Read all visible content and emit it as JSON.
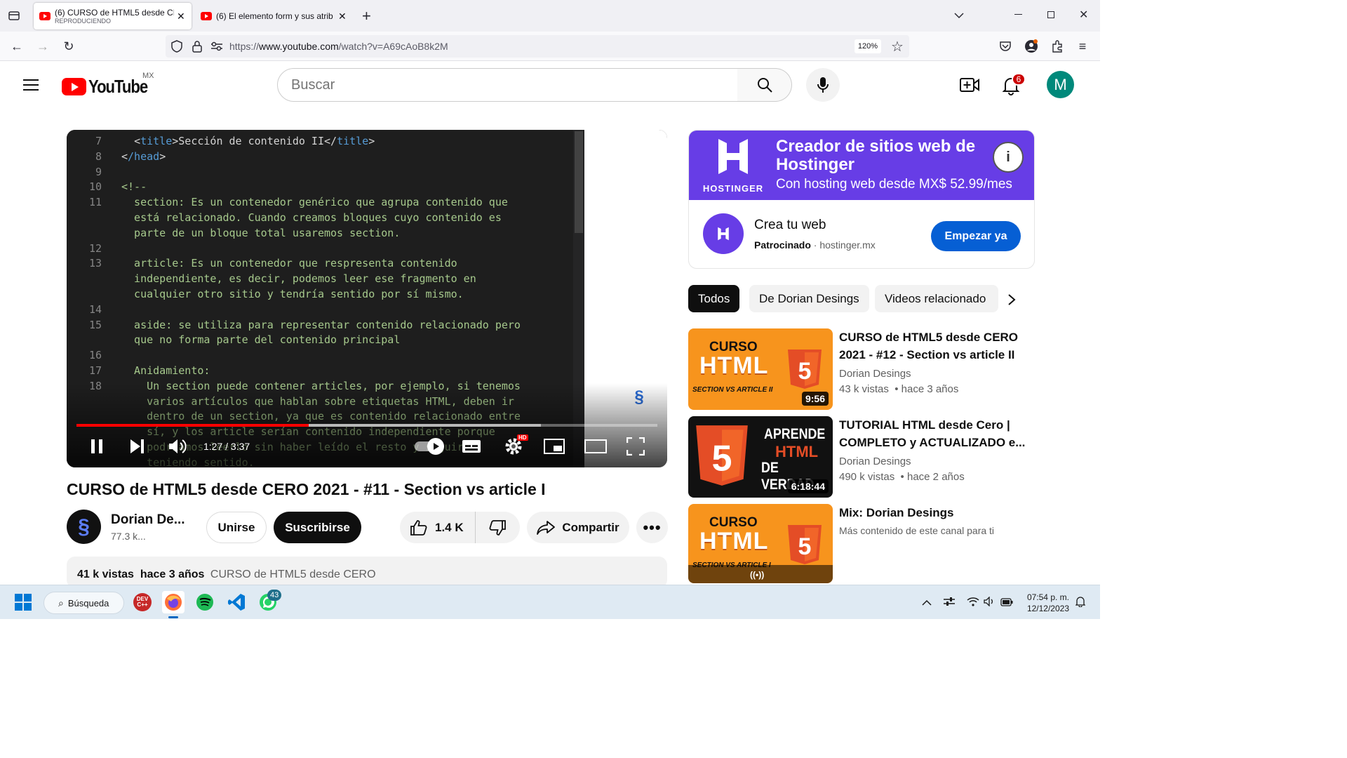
{
  "browser": {
    "tabs": [
      {
        "title": "(6) CURSO de HTML5 desde CE",
        "subtitle": "REPRODUCIENDO",
        "active": true
      },
      {
        "title": "(6) El elemento form y sus atrib",
        "active": false
      }
    ],
    "url_prefix": "https://",
    "url_host": "www.youtube.com",
    "url_path": "/watch?v=A69cAoB8k2M",
    "zoom": "120%"
  },
  "youtube": {
    "logo_text": "YouTube",
    "country": "MX",
    "search_placeholder": "Buscar",
    "notifications": "6",
    "avatar_letter": "M"
  },
  "video": {
    "code_lines": [
      {
        "n": "7",
        "text": "  <title>Sección de contenido II</title>"
      },
      {
        "n": "8",
        "text": "</head>"
      },
      {
        "n": "9",
        "text": ""
      },
      {
        "n": "10",
        "text": "<!--"
      },
      {
        "n": "11",
        "text": "  section: Es un contenedor genérico que agrupa contenido que"
      },
      {
        "n": "",
        "text": "  está relacionado. Cuando creamos bloques cuyo contenido es"
      },
      {
        "n": "",
        "text": "  parte de un bloque total usaremos section."
      },
      {
        "n": "12",
        "text": ""
      },
      {
        "n": "13",
        "text": "  article: Es un contenedor que respresenta contenido"
      },
      {
        "n": "",
        "text": "  independiente, es decir, podemos leer ese fragmento en"
      },
      {
        "n": "",
        "text": "  cualquier otro sitio y tendría sentido por sí mismo."
      },
      {
        "n": "14",
        "text": ""
      },
      {
        "n": "15",
        "text": "  aside: se utiliza para representar contenido relacionado pero"
      },
      {
        "n": "",
        "text": "  que no forma parte del contenido principal"
      },
      {
        "n": "16",
        "text": ""
      },
      {
        "n": "17",
        "text": "  Anidamiento:"
      },
      {
        "n": "18",
        "text": "    Un section puede contener articles, por ejemplo, si tenemos"
      },
      {
        "n": "",
        "text": "    varios artículos que hablan sobre etiquetas HTML, deben ir"
      },
      {
        "n": "",
        "text": "    dentro de un section, ya que es contenido relacionado entre"
      },
      {
        "n": "",
        "text": "    sí, y los article serían contenido independiente porque"
      },
      {
        "n": "",
        "text": "    podríamos leerlo sin haber leído el resto y seguiría"
      },
      {
        "n": "",
        "text": "    teniendo sentido."
      }
    ],
    "time_current": "1:27",
    "time_total": "3:37",
    "progress": 0.4,
    "buffered": 0.8,
    "title": "CURSO de HTML5 desde CERO 2021 - #11 - Section vs article I",
    "channel_name": "Dorian De...",
    "subscribers": "77.3 k...",
    "join_label": "Unirse",
    "subscribe_label": "Suscribirse",
    "likes": "1.4 K",
    "share_label": "Compartir",
    "views": "41 k vistas",
    "age": "hace 3 años",
    "playlist_tag": "CURSO de HTML5 desde CERO"
  },
  "ad": {
    "banner_title": "Creador de sitios web de Hostinger",
    "banner_sub": "Con hosting web desde MX$ 52.99/mes",
    "brand": "HOSTINGER",
    "name": "Crea tu web",
    "sponsored": "Patrocinado",
    "domain": "hostinger.mx",
    "cta": "Empezar ya"
  },
  "chips": [
    "Todos",
    "De Dorian Desings",
    "Videos relacionado"
  ],
  "recommendations": [
    {
      "title": "CURSO de HTML5 desde CERO 2021 - #12 - Section vs article II",
      "channel": "Dorian Desings",
      "views": "43 k vistas",
      "age": "hace 3 años",
      "duration": "9:56",
      "thumb_top": "CURSO",
      "thumb_main": "HTML",
      "thumb_bottom": "SECTION VS ARTICLE II",
      "thumb_color": "#f7941d"
    },
    {
      "title": "TUTORIAL HTML desde Cero | COMPLETO y ACTUALIZADO e...",
      "channel": "Dorian Desings",
      "views": "490 k vistas",
      "age": "hace 2 años",
      "duration": "6:18:44",
      "thumb_top": "APRENDE",
      "thumb_main": "HTML",
      "thumb_bottom": "DE VERDAD",
      "thumb_color": "#111111"
    },
    {
      "title": "Mix: Dorian Desings",
      "channel": "Más contenido de este canal para ti",
      "thumb_top": "CURSO",
      "thumb_main": "HTML",
      "thumb_bottom": "SECTION VS ARTICLE I",
      "thumb_color": "#f7941d"
    }
  ],
  "taskbar": {
    "search_label": "Búsqueda",
    "whatsapp_badge": "43",
    "time": "07:54 p. m.",
    "date": "12/12/2023"
  }
}
